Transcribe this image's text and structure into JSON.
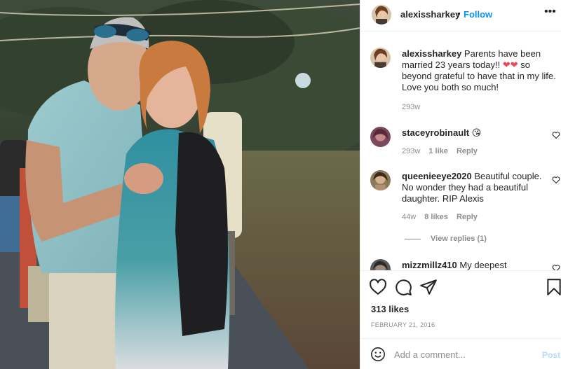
{
  "header": {
    "username": "alexissharkey",
    "separator": "•",
    "follow_label": "Follow",
    "more_icon": "more-options-icon"
  },
  "caption": {
    "username": "alexissharkey",
    "text_before": "Parents have been married 23 years today!!",
    "emoji": "❤❤",
    "text_after": "so beyond grateful to have that in my life. Love you both so much!",
    "time": "293w"
  },
  "comments": [
    {
      "username": "staceyrobinault",
      "text": "",
      "emoji": "😘",
      "time": "293w",
      "likes": "1 like",
      "reply_label": "Reply"
    },
    {
      "username": "queenieeye2020",
      "text": "Beautiful couple. No wonder they had a beautiful daughter. RIP Alexis",
      "emoji": "",
      "time": "44w",
      "likes": "8 likes",
      "reply_label": "Reply",
      "view_replies": "View replies (1)"
    },
    {
      "username": "mizzmillz410",
      "text": "My deepest",
      "emoji": "",
      "time": "",
      "likes": "",
      "reply_label": ""
    }
  ],
  "actions": {
    "like_icon": "heart-icon",
    "comment_icon": "comment-icon",
    "share_icon": "share-icon",
    "save_icon": "bookmark-icon"
  },
  "likes_count": "313 likes",
  "post_date": "FEBRUARY 21, 2016",
  "add_comment": {
    "placeholder": "Add a comment...",
    "post_label": "Post",
    "emoji_icon": "emoji-icon"
  },
  "colors": {
    "accent": "#0095f6",
    "post_disabled": "#b3dbff",
    "text": "#262626",
    "muted": "#8e8e8e",
    "heart_red": "#ed4956"
  }
}
